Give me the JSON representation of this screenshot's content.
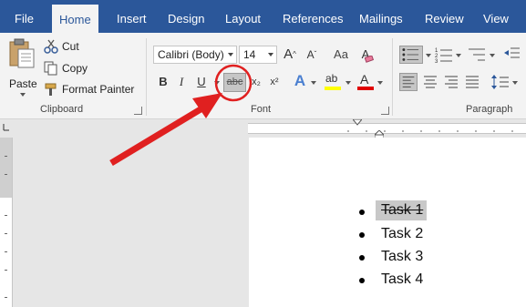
{
  "tabs": [
    {
      "label": "File",
      "active": false
    },
    {
      "label": "Home",
      "active": true
    },
    {
      "label": "Insert",
      "active": false
    },
    {
      "label": "Design",
      "active": false
    },
    {
      "label": "Layout",
      "active": false
    },
    {
      "label": "References",
      "active": false
    },
    {
      "label": "Mailings",
      "active": false
    },
    {
      "label": "Review",
      "active": false
    },
    {
      "label": "View",
      "active": false
    }
  ],
  "clipboard": {
    "paste_label": "Paste",
    "cut_label": "Cut",
    "copy_label": "Copy",
    "format_painter_label": "Format Painter",
    "group_label": "Clipboard"
  },
  "font": {
    "font_name": "Calibri (Body)",
    "font_size": "14",
    "bold_label": "B",
    "italic_label": "I",
    "underline_label": "U",
    "strike_label": "abc",
    "subscript_label": "x₂",
    "superscript_label": "x²",
    "text_effects_label": "A",
    "highlight_label": "ab",
    "font_color_label": "A",
    "grow_label": "A",
    "shrink_label": "A",
    "clear_label": "A",
    "group_label": "Font",
    "font_color_hex": "#e00000",
    "highlight_hex": "#ffff00"
  },
  "paragraph": {
    "group_label": "Paragraph"
  },
  "annotation": {
    "arrow_color": "#e02020"
  },
  "document": {
    "items": [
      "Task 1",
      "Task 2",
      "Task 3",
      "Task 4"
    ],
    "struck_item_index": 0
  }
}
